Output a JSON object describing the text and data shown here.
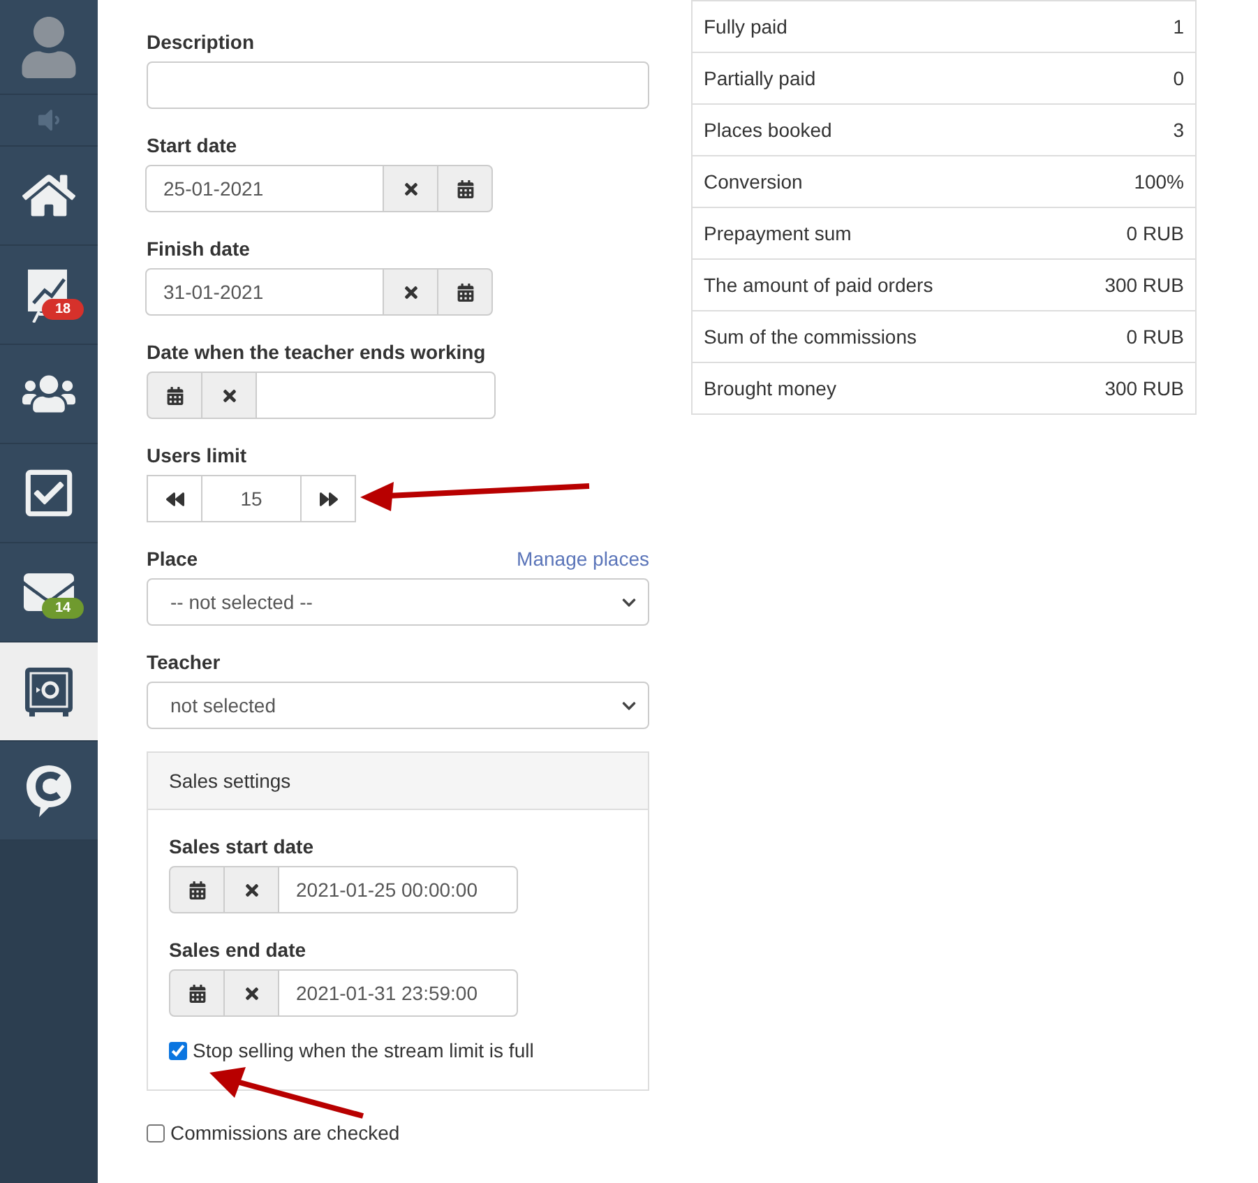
{
  "sidebar": {
    "items": [
      {
        "kind": "avatar",
        "selected": false
      },
      {
        "kind": "sound",
        "selected": false
      },
      {
        "kind": "home",
        "selected": false
      },
      {
        "kind": "chart",
        "selected": false,
        "badge": "18",
        "color": "#d6312b"
      },
      {
        "kind": "people",
        "selected": false
      },
      {
        "kind": "tasks",
        "selected": false
      },
      {
        "kind": "mail",
        "selected": false,
        "badge": "14",
        "color": "#6f9a2e"
      },
      {
        "kind": "safe",
        "selected": true
      },
      {
        "kind": "chat",
        "selected": false
      }
    ]
  },
  "form": {
    "fields": [
      {
        "kind": "text",
        "label": "Description"
      },
      {
        "kind": "date",
        "label": "Start date",
        "value": "25-01-2021"
      },
      {
        "kind": "date",
        "label": "Finish date",
        "value": "31-01-2021"
      },
      {
        "kind": "date_reverse",
        "label": "Date when the teacher ends working"
      },
      {
        "kind": "stepper",
        "label": "Users limit",
        "value": "15"
      },
      {
        "kind": "select",
        "label": "Place",
        "value": "-- not selected --",
        "link": "Manage places"
      },
      {
        "kind": "select",
        "label": "Teacher",
        "value": "not selected"
      }
    ]
  },
  "sales_settings": {
    "title": "Sales settings",
    "fields": [
      {
        "kind": "date_reverse",
        "label": "Sales start date",
        "value": "2021-01-25 00:00:00"
      },
      {
        "kind": "date_reverse",
        "label": "Sales end date",
        "value": "2021-01-31 23:59:00"
      }
    ],
    "stop_selling": {
      "label": "Stop selling when the stream limit is full",
      "checked": true
    }
  },
  "commissions": {
    "label": "Commissions are checked",
    "checked": false
  },
  "stats": {
    "rows": [
      {
        "label": "Fully paid",
        "value": "1"
      },
      {
        "label": "Partially paid",
        "value": "0"
      },
      {
        "label": "Places booked",
        "value": "3"
      },
      {
        "label": "Conversion",
        "value": "100%"
      },
      {
        "label": "Prepayment sum",
        "value": "0 RUB"
      },
      {
        "label": "The amount of paid orders",
        "value": "300 RUB"
      },
      {
        "label": "Sum of the commissions",
        "value": "0 RUB"
      },
      {
        "label": "Brought money",
        "value": "300 RUB"
      }
    ]
  }
}
